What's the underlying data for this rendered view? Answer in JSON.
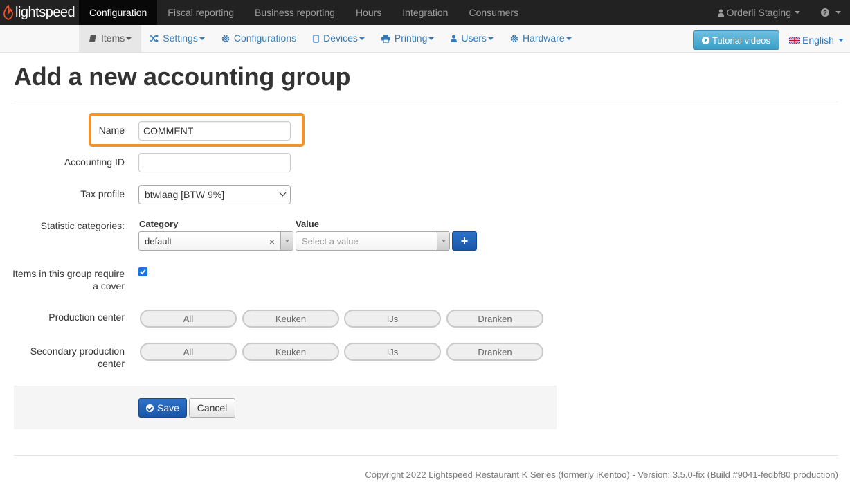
{
  "brand": {
    "logo_text": "lightspeed",
    "accent": "#e8542c"
  },
  "top_nav": {
    "items": [
      "Configuration",
      "Fiscal reporting",
      "Business reporting",
      "Hours",
      "Integration",
      "Consumers"
    ],
    "active": "Configuration",
    "user_label": "Orderli Staging",
    "help_icon": "question-circle-icon"
  },
  "sub_nav": {
    "items": [
      {
        "label": "Items",
        "icon": "book-icon"
      },
      {
        "label": "Settings",
        "icon": "shuffle-icon"
      },
      {
        "label": "Configurations",
        "icon": "gear-icon"
      },
      {
        "label": "Devices",
        "icon": "device-icon"
      },
      {
        "label": "Printing",
        "icon": "printer-icon"
      },
      {
        "label": "Users",
        "icon": "user-icon"
      },
      {
        "label": "Hardware",
        "icon": "gear-icon"
      }
    ],
    "tutorial_label": "Tutorial videos",
    "language_label": "English"
  },
  "page": {
    "title": "Add a new accounting group"
  },
  "form": {
    "name_label": "Name",
    "name_value": "COMMENT",
    "accounting_id_label": "Accounting ID",
    "accounting_id_value": "",
    "tax_profile_label": "Tax profile",
    "tax_profile_value": "btwlaag [BTW 9%]",
    "statistic_label": "Statistic categories:",
    "category_header": "Category",
    "value_header": "Value",
    "category_value": "default",
    "value_placeholder": "Select a value",
    "add_button": "+",
    "cover_label_line1": "Items in this group require",
    "cover_label_line2": "a cover",
    "cover_checked": true,
    "production_center_label": "Production center",
    "secondary_label_line1": "Secondary production",
    "secondary_label_line2": "center",
    "production_options": [
      "All",
      "Keuken",
      "IJs",
      "Dranken"
    ],
    "secondary_options": [
      "All",
      "Keuken",
      "IJs",
      "Dranken"
    ],
    "save_label": "Save",
    "cancel_label": "Cancel"
  },
  "footer": {
    "text": "Copyright 2022 Lightspeed Restaurant K Series (formerly iKentoo) - Version: 3.5.0-fix (Build #9041-fedbf80 production)"
  }
}
